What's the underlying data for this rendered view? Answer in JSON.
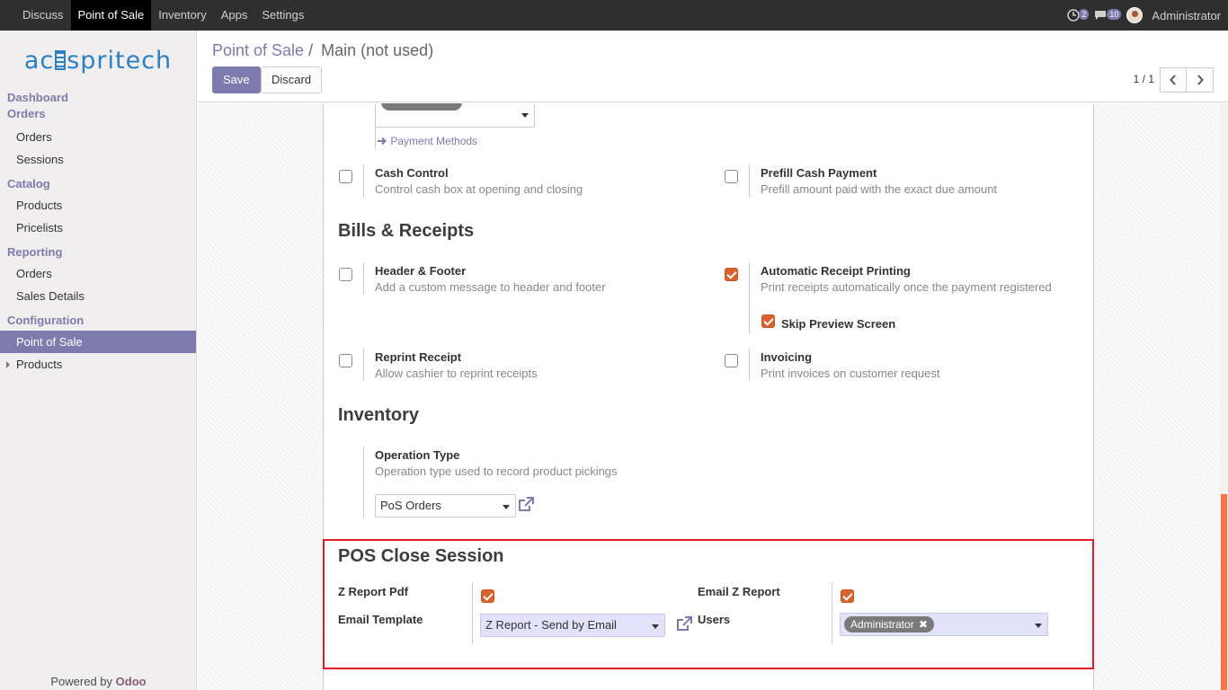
{
  "topbar": {
    "menu": [
      "Discuss",
      "Point of Sale",
      "Inventory",
      "Apps",
      "Settings"
    ],
    "activity_count": "2",
    "messages_count": "10",
    "user": "Administrator"
  },
  "sidebar": {
    "logo_left": "ac",
    "logo_right": "spritech",
    "sections": {
      "dashboard": "Dashboard",
      "orders": "Orders",
      "catalog": "Catalog",
      "reporting": "Reporting",
      "configuration": "Configuration"
    },
    "items": {
      "orders": "Orders",
      "sessions": "Sessions",
      "products": "Products",
      "pricelists": "Pricelists",
      "reporting_orders": "Orders",
      "sales_details": "Sales Details",
      "point_of_sale": "Point of Sale",
      "config_products": "Products"
    },
    "powered_by": "Powered by",
    "powered_brand": "Odoo"
  },
  "control_panel": {
    "breadcrumb_parent": "Point of Sale",
    "breadcrumb_sep": "/",
    "breadcrumb_current": "Main (not used)",
    "save_label": "Save",
    "discard_label": "Discard",
    "pager": "1 / 1"
  },
  "form": {
    "payment_methods_link": "Payment Methods",
    "cash_control": {
      "label": "Cash Control",
      "desc": "Control cash box at opening and closing",
      "checked": false
    },
    "prefill_cash": {
      "label": "Prefill Cash Payment",
      "desc": "Prefill amount paid with the exact due amount",
      "checked": false
    },
    "bills_title": "Bills & Receipts",
    "header_footer": {
      "label": "Header & Footer",
      "desc": "Add a custom message to header and footer",
      "checked": false
    },
    "auto_receipt": {
      "label": "Automatic Receipt Printing",
      "desc": "Print receipts automatically once the payment registered",
      "checked": true
    },
    "skip_preview": {
      "label": "Skip Preview Screen",
      "checked": true
    },
    "reprint": {
      "label": "Reprint Receipt",
      "desc": "Allow cashier to reprint receipts",
      "checked": false
    },
    "invoicing": {
      "label": "Invoicing",
      "desc": "Print invoices on customer request",
      "checked": false
    },
    "inventory_title": "Inventory",
    "operation_type": {
      "label": "Operation Type",
      "desc": "Operation type used to record product pickings",
      "value": "PoS Orders"
    },
    "close_session_title": "POS Close Session",
    "z_report_pdf": {
      "label": "Z Report Pdf",
      "checked": true
    },
    "email_z_report": {
      "label": "Email Z Report",
      "checked": true
    },
    "email_template": {
      "label": "Email Template",
      "value": "Z Report - Send by Email"
    },
    "users": {
      "label": "Users",
      "tag": "Administrator"
    }
  }
}
